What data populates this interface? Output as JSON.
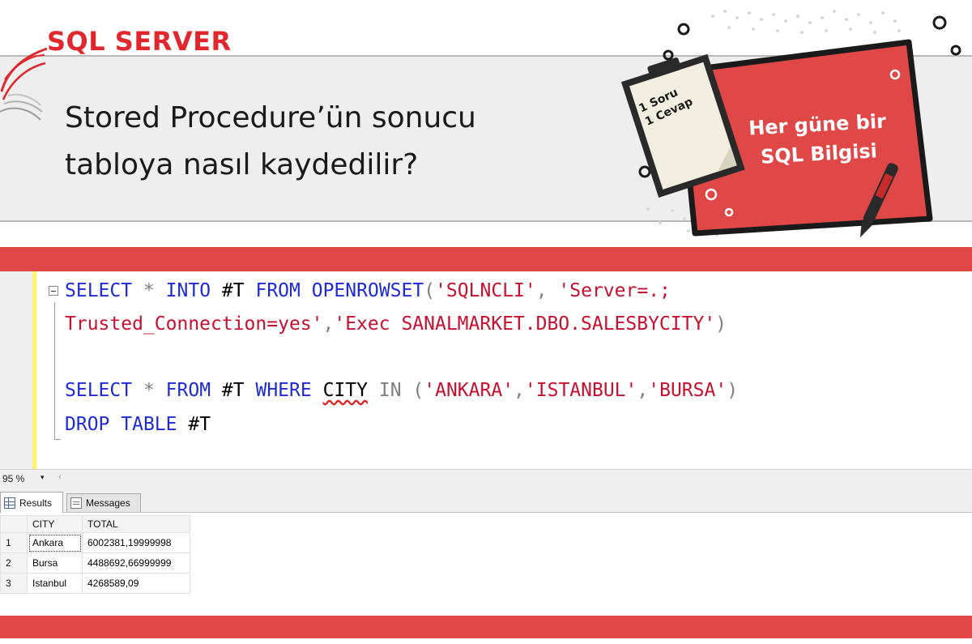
{
  "header": {
    "brand": "SQL SERVER",
    "headline_line1": "Stored Procedure’ün sonucu",
    "headline_line2": "tabloya nasıl kaydedilir?",
    "badge_line1": "Her güne bir",
    "badge_line2": "SQL Bilgisi",
    "note_line1": "1 Soru",
    "note_line2": "1 Cevap",
    "accent_color": "#e1272d"
  },
  "editor": {
    "line1": {
      "kw1": "SELECT",
      "op1": "*",
      "kw2": "INTO",
      "def1": "#T",
      "kw3": "FROM",
      "kw4": "OPENROWSET",
      "p1": "(",
      "s1": "'SQLNCLI'",
      "c1": ",",
      "s2": "'Server=.;"
    },
    "line2": {
      "s1": "Trusted_Connection=yes'",
      "c1": ",",
      "s2": "'Exec SANALMARKET.DBO.SALESBYCITY'",
      "p1": ")"
    },
    "line3": {
      "kw1": "SELECT",
      "op1": "*",
      "kw2": "FROM",
      "def1": "#T",
      "kw3": "WHERE",
      "col1": "CITY",
      "op2": "IN",
      "p1": "(",
      "s1": "'ANKARA'",
      "c1": ",",
      "s2": "'ISTANBUL'",
      "c2": ",",
      "s3": "'BURSA'",
      "p2": ")"
    },
    "line4": {
      "kw1": "DROP",
      "kw2": "TABLE",
      "def1": "#T"
    }
  },
  "status": {
    "zoom": "95 %",
    "zoom_caret": "▾",
    "scroll_left": "‹"
  },
  "results_tabs": {
    "results": "Results",
    "messages": "Messages"
  },
  "results_grid": {
    "columns": [
      "CITY",
      "TOTAL"
    ],
    "rows": [
      {
        "n": "1",
        "city": "Ankara",
        "total": "6002381,19999998"
      },
      {
        "n": "2",
        "city": "Bursa",
        "total": "4488692,66999999"
      },
      {
        "n": "3",
        "city": "Istanbul",
        "total": "4268589,09"
      }
    ]
  }
}
